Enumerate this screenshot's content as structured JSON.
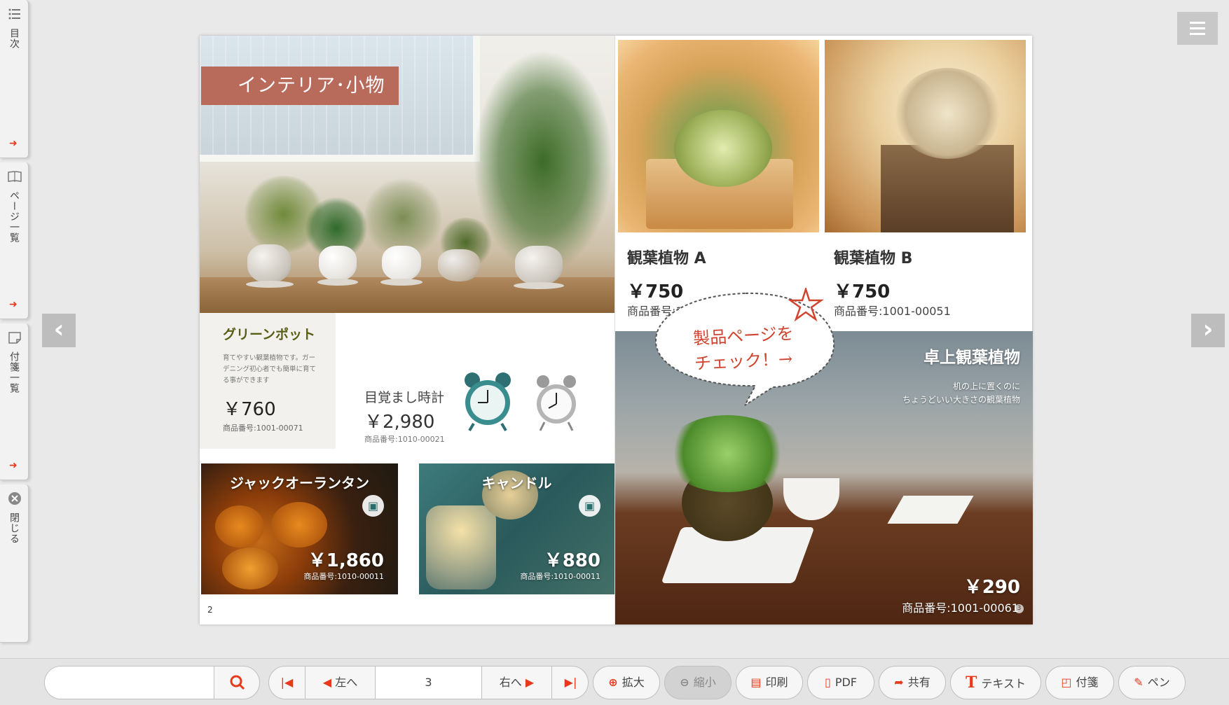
{
  "sidebar": {
    "toc_label": "目次",
    "pages_label": "ページ一覧",
    "notes_label": "付箋一覧",
    "close_label": "閉じる"
  },
  "left_page": {
    "category": "インテリア･小物",
    "green_pot": {
      "title": "グリーンポット",
      "desc": "育てやすい観葉植物です。ガーデニング初心者でも簡単に育てる事ができます",
      "price": "￥760",
      "code": "商品番号:1001-00071"
    },
    "clock": {
      "title": "目覚まし時計",
      "price": "￥2,980",
      "code": "商品番号:1010-00021"
    },
    "jack": {
      "title": "ジャックオーランタン",
      "price": "￥1,860",
      "code": "商品番号:1010-00011"
    },
    "candle": {
      "title": "キャンドル",
      "price": "￥880",
      "code": "商品番号:1010-00011"
    },
    "page_number": "2"
  },
  "right_page": {
    "plant_a": {
      "name": "観葉植物 A",
      "price": "￥750",
      "code": "商品番号:1001-00051"
    },
    "plant_b": {
      "name": "観葉植物 B",
      "price": "￥750",
      "code": "商品番号:1001-00051"
    },
    "bubble": {
      "line1": "製品ページを",
      "line2": "チェック！→"
    },
    "desk_plant": {
      "title": "卓上観葉植物",
      "desc1": "机の上に置くのに",
      "desc2": "ちょうどいい大きさの観葉植物",
      "price": "￥290",
      "code": "商品番号:1001-00061"
    },
    "page_number": "3"
  },
  "toolbar": {
    "search_value": "",
    "left_label": "左へ",
    "page_value": "3",
    "right_label": "右へ",
    "zoom_in": "拡大",
    "zoom_out": "縮小",
    "print": "印刷",
    "pdf": "PDF",
    "share": "共有",
    "text": "テキスト",
    "note": "付箋",
    "pen": "ペン"
  },
  "colors": {
    "accent": "#e8391d",
    "banner": "#b86a5b",
    "green_title": "#5a5d15"
  }
}
